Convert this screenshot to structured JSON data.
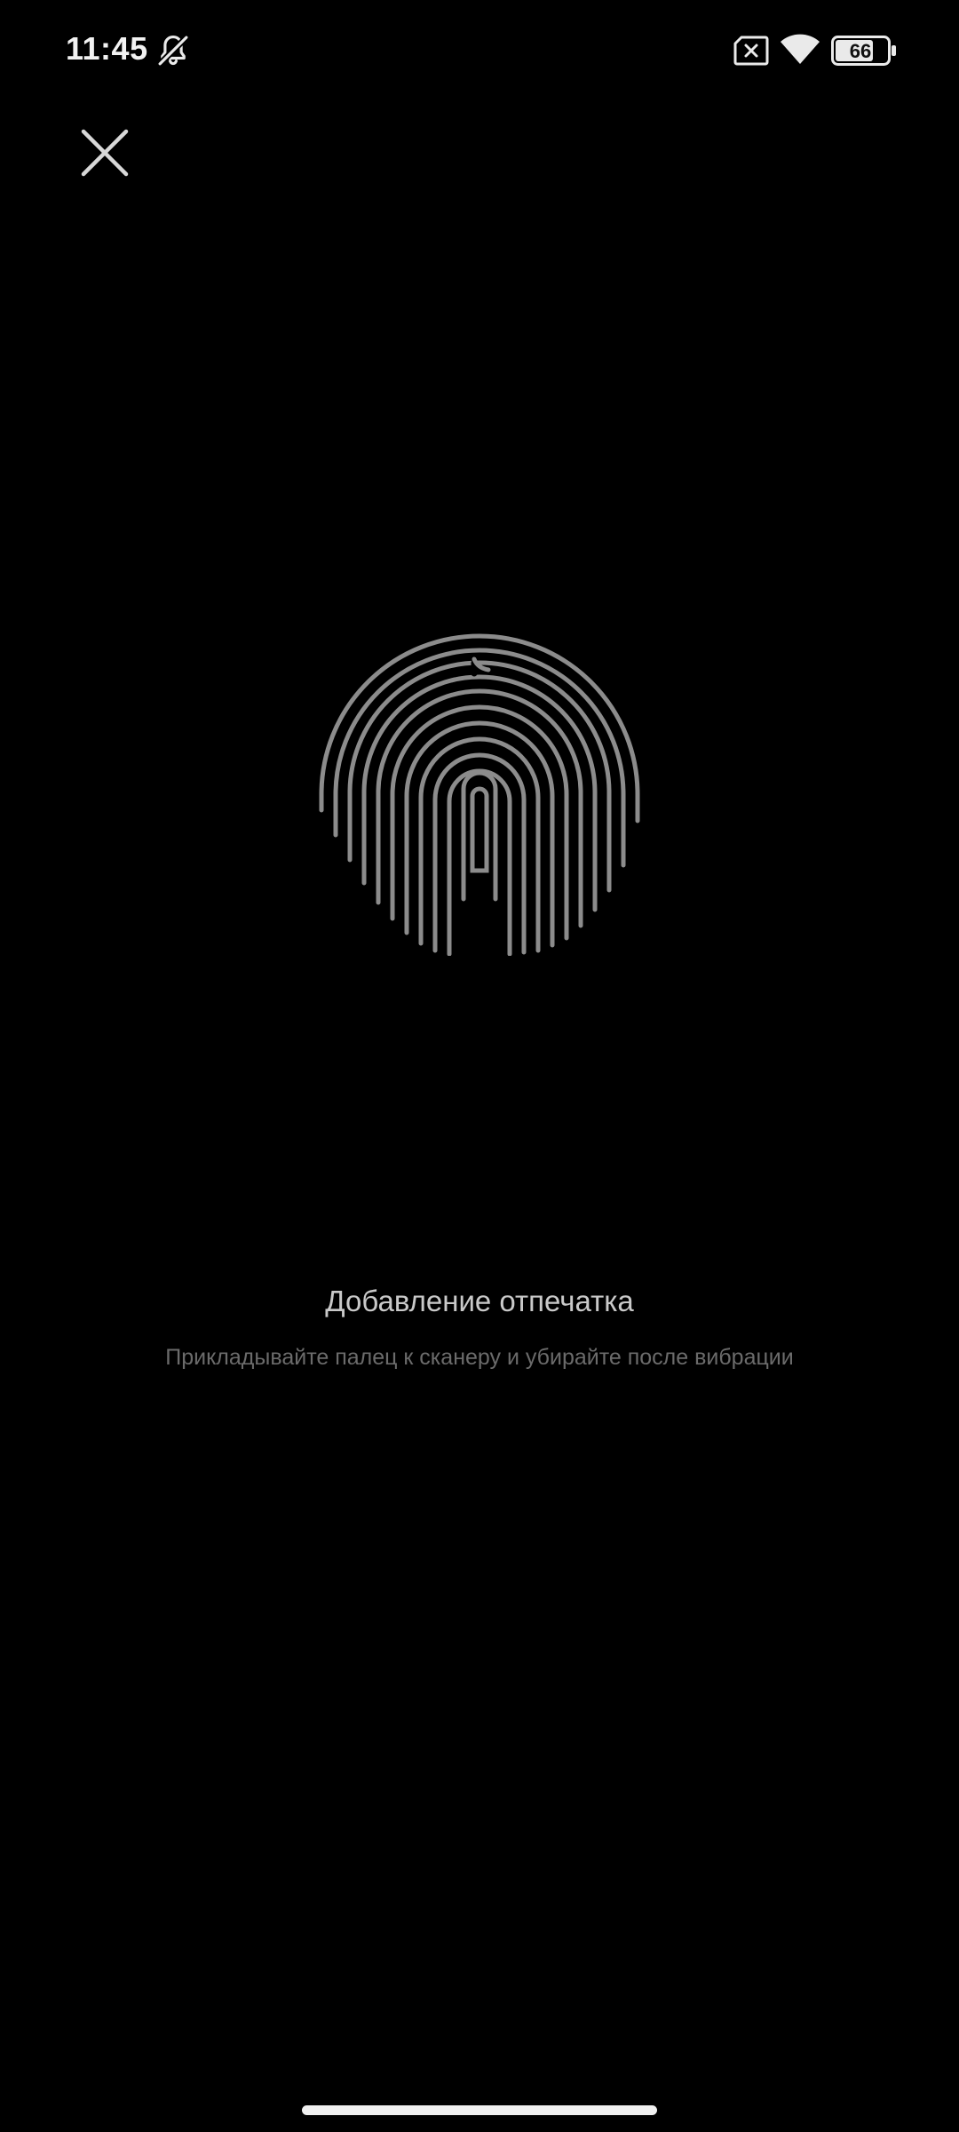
{
  "status_bar": {
    "time": "11:45",
    "icons": [
      "bell-muted-icon",
      "sim-disabled-icon",
      "wifi-icon",
      "battery-icon"
    ],
    "battery_level": "66"
  },
  "close_button": {
    "icon": "close-icon"
  },
  "fingerprint": {
    "icon": "fingerprint-icon",
    "color": "#8c8c8c"
  },
  "prompt": {
    "title": "Добавление отпечатка",
    "subtitle": "Прикладывайте палец к сканеру и убирайте после вибрации"
  },
  "colors": {
    "background": "#000000",
    "title": "#c9c9c9",
    "subtitle": "#6b6b6b"
  }
}
